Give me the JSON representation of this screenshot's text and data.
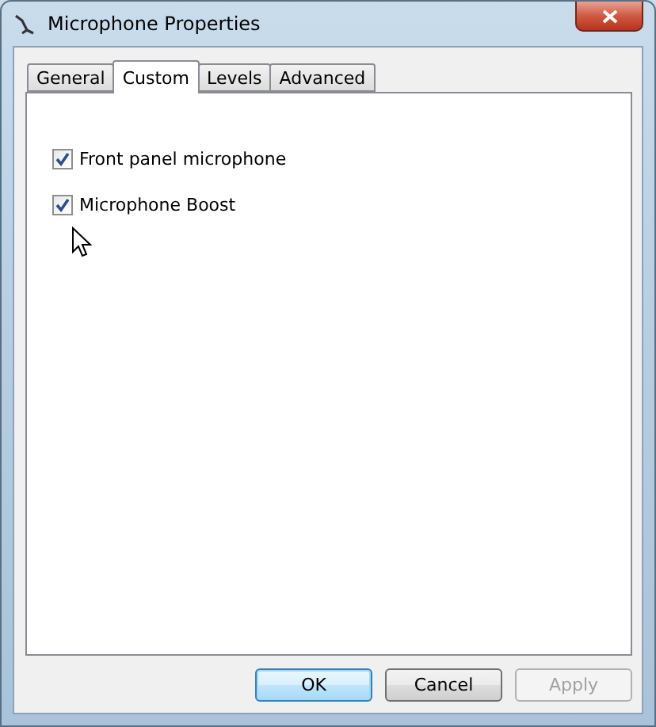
{
  "window": {
    "title": "Microphone Properties"
  },
  "tabs": [
    {
      "label": "General",
      "selected": false
    },
    {
      "label": "Custom",
      "selected": true
    },
    {
      "label": "Levels",
      "selected": false
    },
    {
      "label": "Advanced",
      "selected": false
    }
  ],
  "options": [
    {
      "label": "Front panel microphone",
      "checked": true
    },
    {
      "label": "Microphone Boost",
      "checked": true
    }
  ],
  "buttons": [
    {
      "label": "OK",
      "default": true,
      "disabled": false
    },
    {
      "label": "Cancel",
      "default": false,
      "disabled": false
    },
    {
      "label": "Apply",
      "default": false,
      "disabled": true
    }
  ]
}
